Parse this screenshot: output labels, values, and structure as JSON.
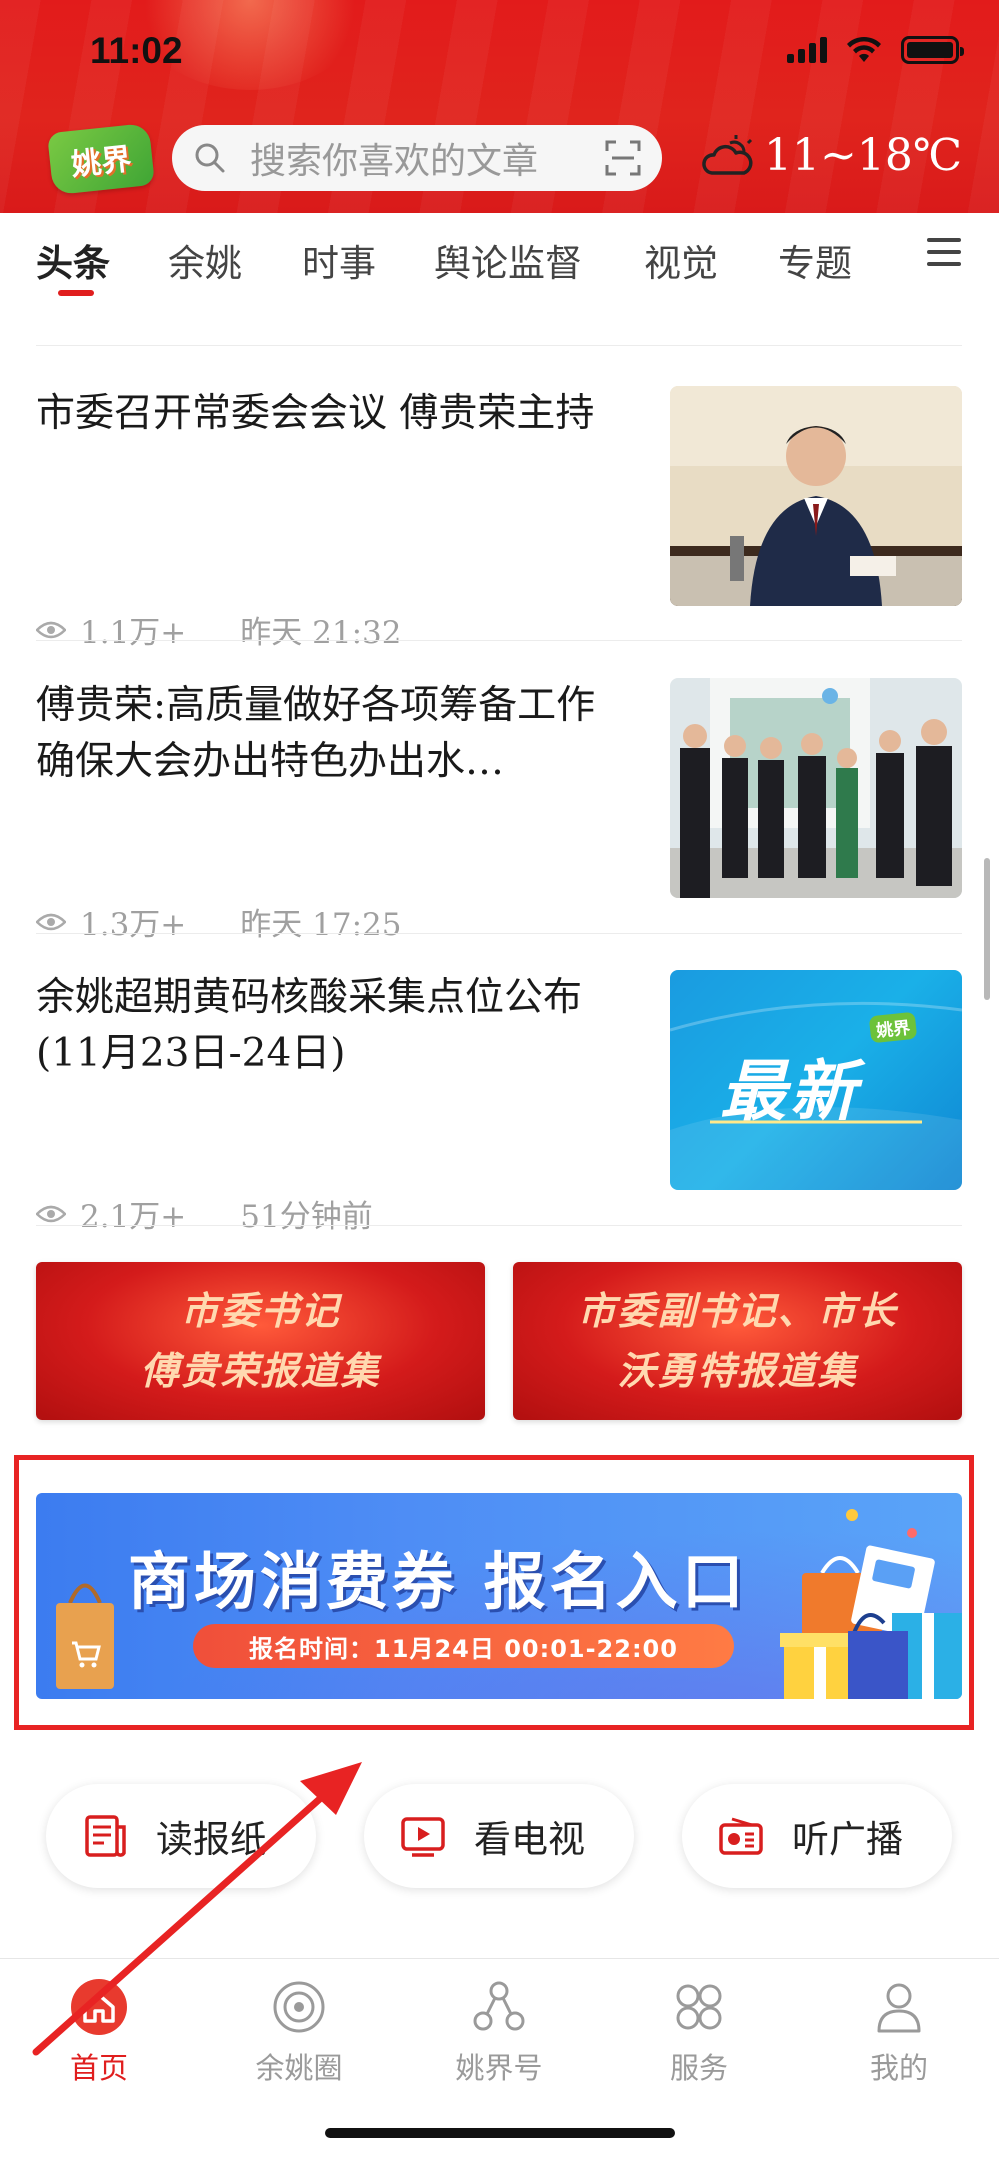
{
  "status_bar": {
    "time": "11:02"
  },
  "header": {
    "logo_text": "姚界",
    "search_placeholder": "搜索你喜欢的文章",
    "weather_temp": "11~18℃"
  },
  "tabs": [
    "头条",
    "余姚",
    "时事",
    "舆论监督",
    "视觉",
    "专题"
  ],
  "news": [
    {
      "title": "市委召开常委会会议 傅贵荣主持",
      "views": "1.1万+",
      "time": "昨天 21:32"
    },
    {
      "title": "傅贵荣:高质量做好各项筹备工作 确保大会办出特色办出水…",
      "views": "1.3万+",
      "time": "昨天 17:25"
    },
    {
      "title": "余姚超期黄码核酸采集点位公布(11月23日-24日)",
      "views": "2.1万+",
      "time": "51分钟前",
      "thumb_text": "最新",
      "thumb_logo": "姚界"
    }
  ],
  "banners": {
    "left": {
      "line1": "市委书记",
      "line2": "傅贵荣报道集"
    },
    "right": {
      "line1": "市委副书记、市长",
      "line2": "沃勇特报道集"
    }
  },
  "coupon": {
    "title": "商场消费券 报名入口",
    "time": "报名时间：11月24日 00:01-22:00"
  },
  "quick_links": [
    "读报纸",
    "看电视",
    "听广播"
  ],
  "bottom_nav": [
    "首页",
    "余姚圈",
    "姚界号",
    "服务",
    "我的"
  ],
  "colors": {
    "brand_red": "#e01e1e",
    "coupon_blue": "#4e8df5",
    "highlight_red": "#e82323"
  }
}
